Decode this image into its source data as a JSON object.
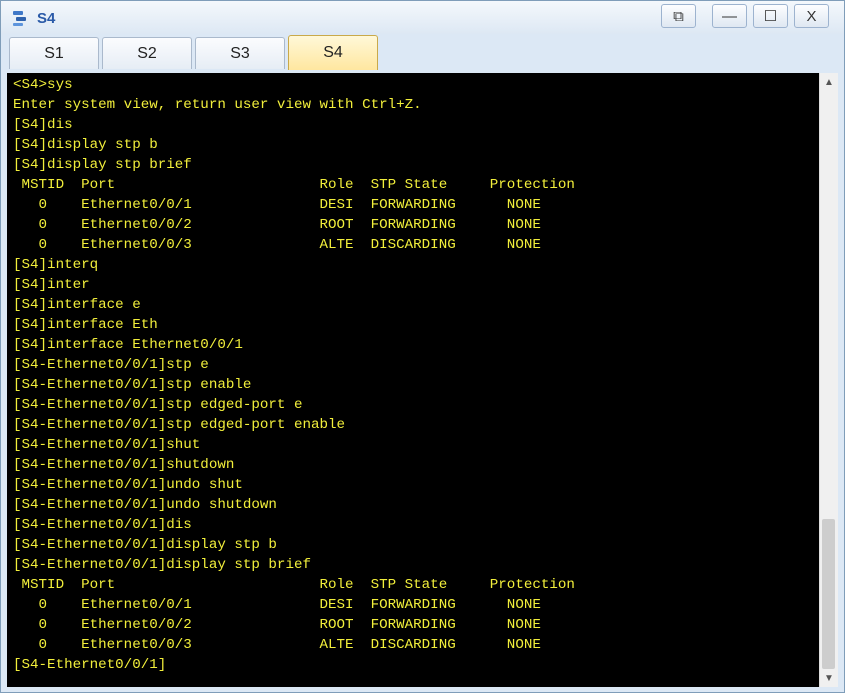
{
  "window": {
    "title": "S4",
    "controls": {
      "restore": "⧉",
      "minimize": "—",
      "maximize": "☐",
      "close": "X"
    }
  },
  "tabs": [
    {
      "label": "S1",
      "active": false
    },
    {
      "label": "S2",
      "active": false
    },
    {
      "label": "S3",
      "active": false
    },
    {
      "label": "S4",
      "active": true
    }
  ],
  "terminal": {
    "lines": [
      "<S4>sys",
      "Enter system view, return user view with Ctrl+Z.",
      "[S4]dis",
      "[S4]display stp b",
      "[S4]display stp brief",
      " MSTID  Port                        Role  STP State     Protection",
      "   0    Ethernet0/0/1               DESI  FORWARDING      NONE",
      "   0    Ethernet0/0/2               ROOT  FORWARDING      NONE",
      "   0    Ethernet0/0/3               ALTE  DISCARDING      NONE",
      "[S4]interq",
      "[S4]inter",
      "[S4]interface e",
      "[S4]interface Eth",
      "[S4]interface Ethernet0/0/1",
      "[S4-Ethernet0/0/1]stp e",
      "[S4-Ethernet0/0/1]stp enable",
      "[S4-Ethernet0/0/1]stp edged-port e",
      "[S4-Ethernet0/0/1]stp edged-port enable",
      "[S4-Ethernet0/0/1]shut",
      "[S4-Ethernet0/0/1]shutdown",
      "[S4-Ethernet0/0/1]undo shut",
      "[S4-Ethernet0/0/1]undo shutdown",
      "[S4-Ethernet0/0/1]dis",
      "[S4-Ethernet0/0/1]display stp b",
      "[S4-Ethernet0/0/1]display stp brief",
      " MSTID  Port                        Role  STP State     Protection",
      "   0    Ethernet0/0/1               DESI  FORWARDING      NONE",
      "   0    Ethernet0/0/2               ROOT  FORWARDING      NONE",
      "   0    Ethernet0/0/3               ALTE  DISCARDING      NONE",
      "[S4-Ethernet0/0/1]"
    ],
    "text_color": "#f2ef3b",
    "background": "#000000"
  },
  "scrollbar": {
    "up_icon": "chevron-up-icon",
    "down_icon": "chevron-down-icon"
  }
}
